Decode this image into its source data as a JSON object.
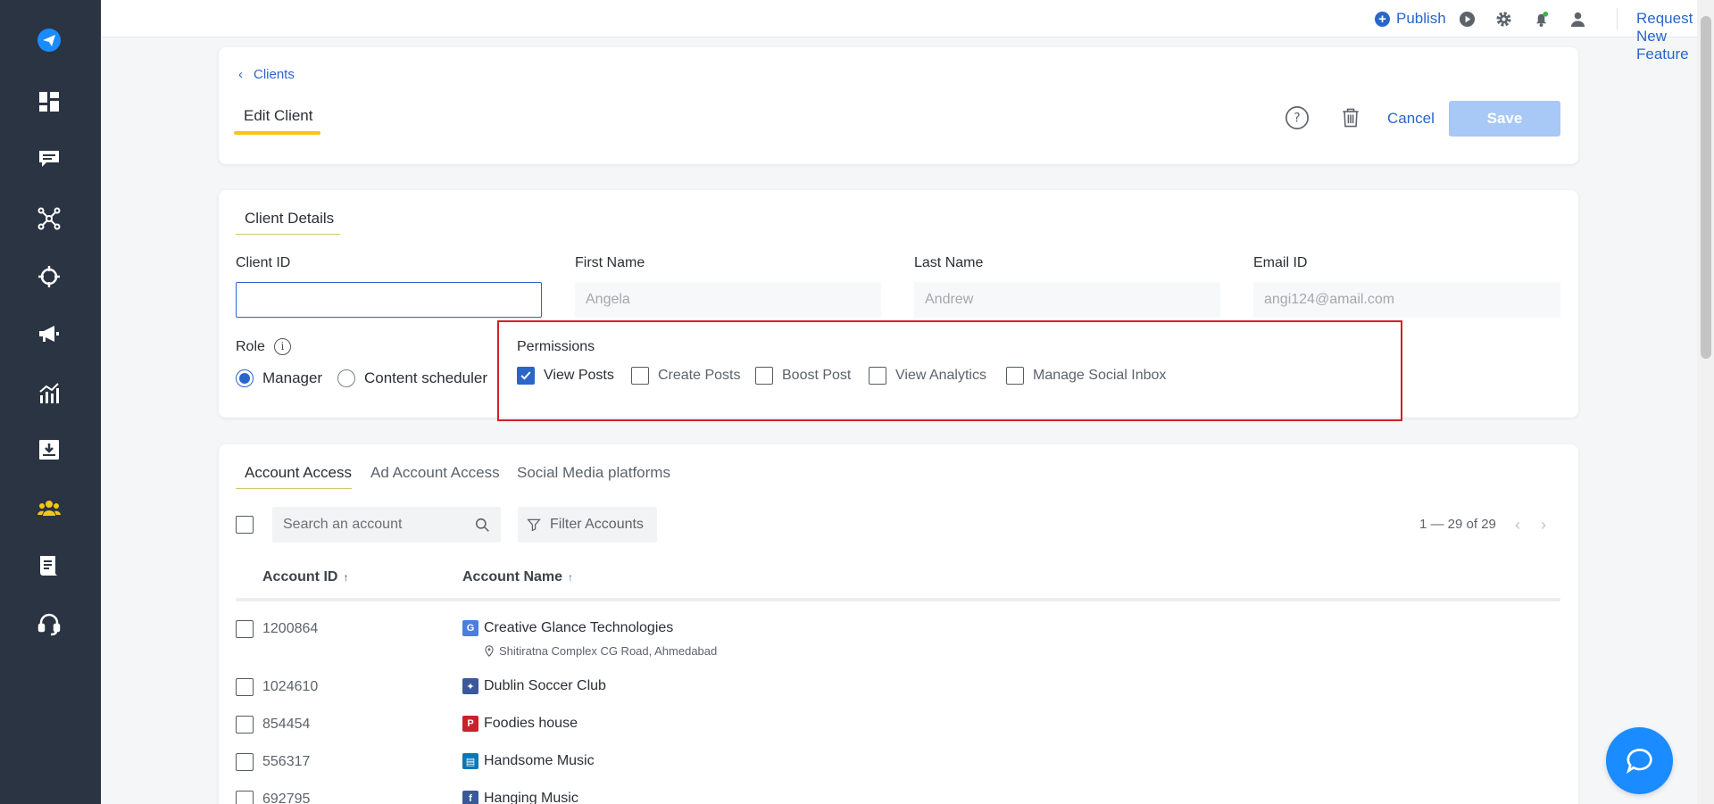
{
  "sidebar": {
    "items": [
      {
        "icon": "paper-plane-icon"
      },
      {
        "icon": "dashboard-icon"
      },
      {
        "icon": "chat-icon"
      },
      {
        "icon": "network-icon"
      },
      {
        "icon": "target-icon"
      },
      {
        "icon": "megaphone-icon"
      },
      {
        "icon": "analytics-icon"
      },
      {
        "icon": "download-icon"
      },
      {
        "icon": "clients-icon"
      },
      {
        "icon": "reports-icon"
      },
      {
        "icon": "headset-icon"
      }
    ],
    "active_color": "#f5c518"
  },
  "topbar": {
    "publish_label": "Publish",
    "request_feature_label": "Request New Feature"
  },
  "header": {
    "breadcrumb": "Clients",
    "tab_label": "Edit Client",
    "cancel_label": "Cancel",
    "save_label": "Save"
  },
  "details": {
    "section_title": "Client Details",
    "fields": {
      "client_id": {
        "label": "Client ID",
        "value": "",
        "placeholder": ""
      },
      "first_name": {
        "label": "First Name",
        "value": "Angela"
      },
      "last_name": {
        "label": "Last Name",
        "value": "Andrew"
      },
      "email": {
        "label": "Email ID",
        "value": "angi124@amail.com"
      }
    },
    "role": {
      "label": "Role",
      "options": [
        {
          "label": "Manager",
          "selected": true
        },
        {
          "label": "Content scheduler",
          "selected": false
        }
      ]
    },
    "permissions": {
      "title": "Permissions",
      "items": [
        {
          "label": "View Posts",
          "checked": true
        },
        {
          "label": "Create Posts",
          "checked": false
        },
        {
          "label": "Boost Post",
          "checked": false
        },
        {
          "label": "View Analytics",
          "checked": false
        },
        {
          "label": "Manage Social Inbox",
          "checked": false
        }
      ]
    }
  },
  "access": {
    "tabs": [
      {
        "label": "Account Access",
        "active": true
      },
      {
        "label": "Ad Account Access",
        "active": false
      },
      {
        "label": "Social Media platforms",
        "active": false
      }
    ],
    "search_placeholder": "Search an account",
    "filter_label": "Filter Accounts",
    "pager": "1 — 29 of 29",
    "columns": {
      "id": "Account ID",
      "name": "Account Name"
    },
    "rows": [
      {
        "id": "1200864",
        "name": "Creative Glance Technologies",
        "platform": "google-business-icon",
        "address": "Shitiratna Complex CG Road, Ahmedabad"
      },
      {
        "id": "1024610",
        "name": "Dublin Soccer Club",
        "platform": "facebook-group-icon"
      },
      {
        "id": "854454",
        "name": "Foodies house",
        "platform": "pinterest-icon"
      },
      {
        "id": "556317",
        "name": "Handsome Music",
        "platform": "linkedin-page-icon"
      },
      {
        "id": "692795",
        "name": "Hanging Music",
        "platform": "facebook-icon"
      }
    ]
  },
  "colors": {
    "accent": "#2a66c9",
    "sidebar_bg": "#2a3442",
    "highlight_border": "#d52027",
    "save_disabled": "#a8c8f5"
  }
}
